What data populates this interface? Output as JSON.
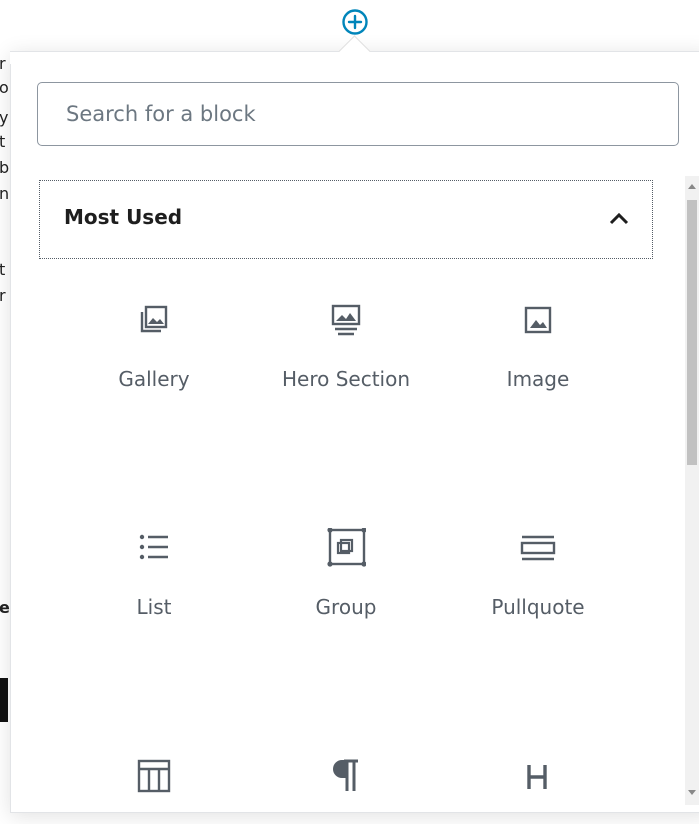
{
  "background_text": {
    "left_fragments": [
      "r",
      "o",
      "y",
      "t",
      "b",
      "n",
      "t",
      "r",
      "e"
    ]
  },
  "inserter_toggle": {
    "icon": "plus-circle-icon"
  },
  "search": {
    "placeholder": "Search for a block",
    "value": ""
  },
  "section": {
    "title": "Most Used",
    "expanded": true,
    "icon": "chevron-up-icon"
  },
  "blocks": [
    {
      "label": "Gallery",
      "icon": "gallery-icon"
    },
    {
      "label": "Hero Section",
      "icon": "hero-section-icon"
    },
    {
      "label": "Image",
      "icon": "image-icon"
    },
    {
      "label": "List",
      "icon": "list-icon"
    },
    {
      "label": "Group",
      "icon": "group-icon"
    },
    {
      "label": "Pullquote",
      "icon": "pullquote-icon"
    },
    {
      "label": "",
      "icon": "table-icon"
    },
    {
      "label": "",
      "icon": "paragraph-icon"
    },
    {
      "label": "",
      "icon": "heading-icon"
    }
  ],
  "colors": {
    "accent": "#0085ba",
    "icon": "#555d66",
    "border": "#8d96a0"
  }
}
